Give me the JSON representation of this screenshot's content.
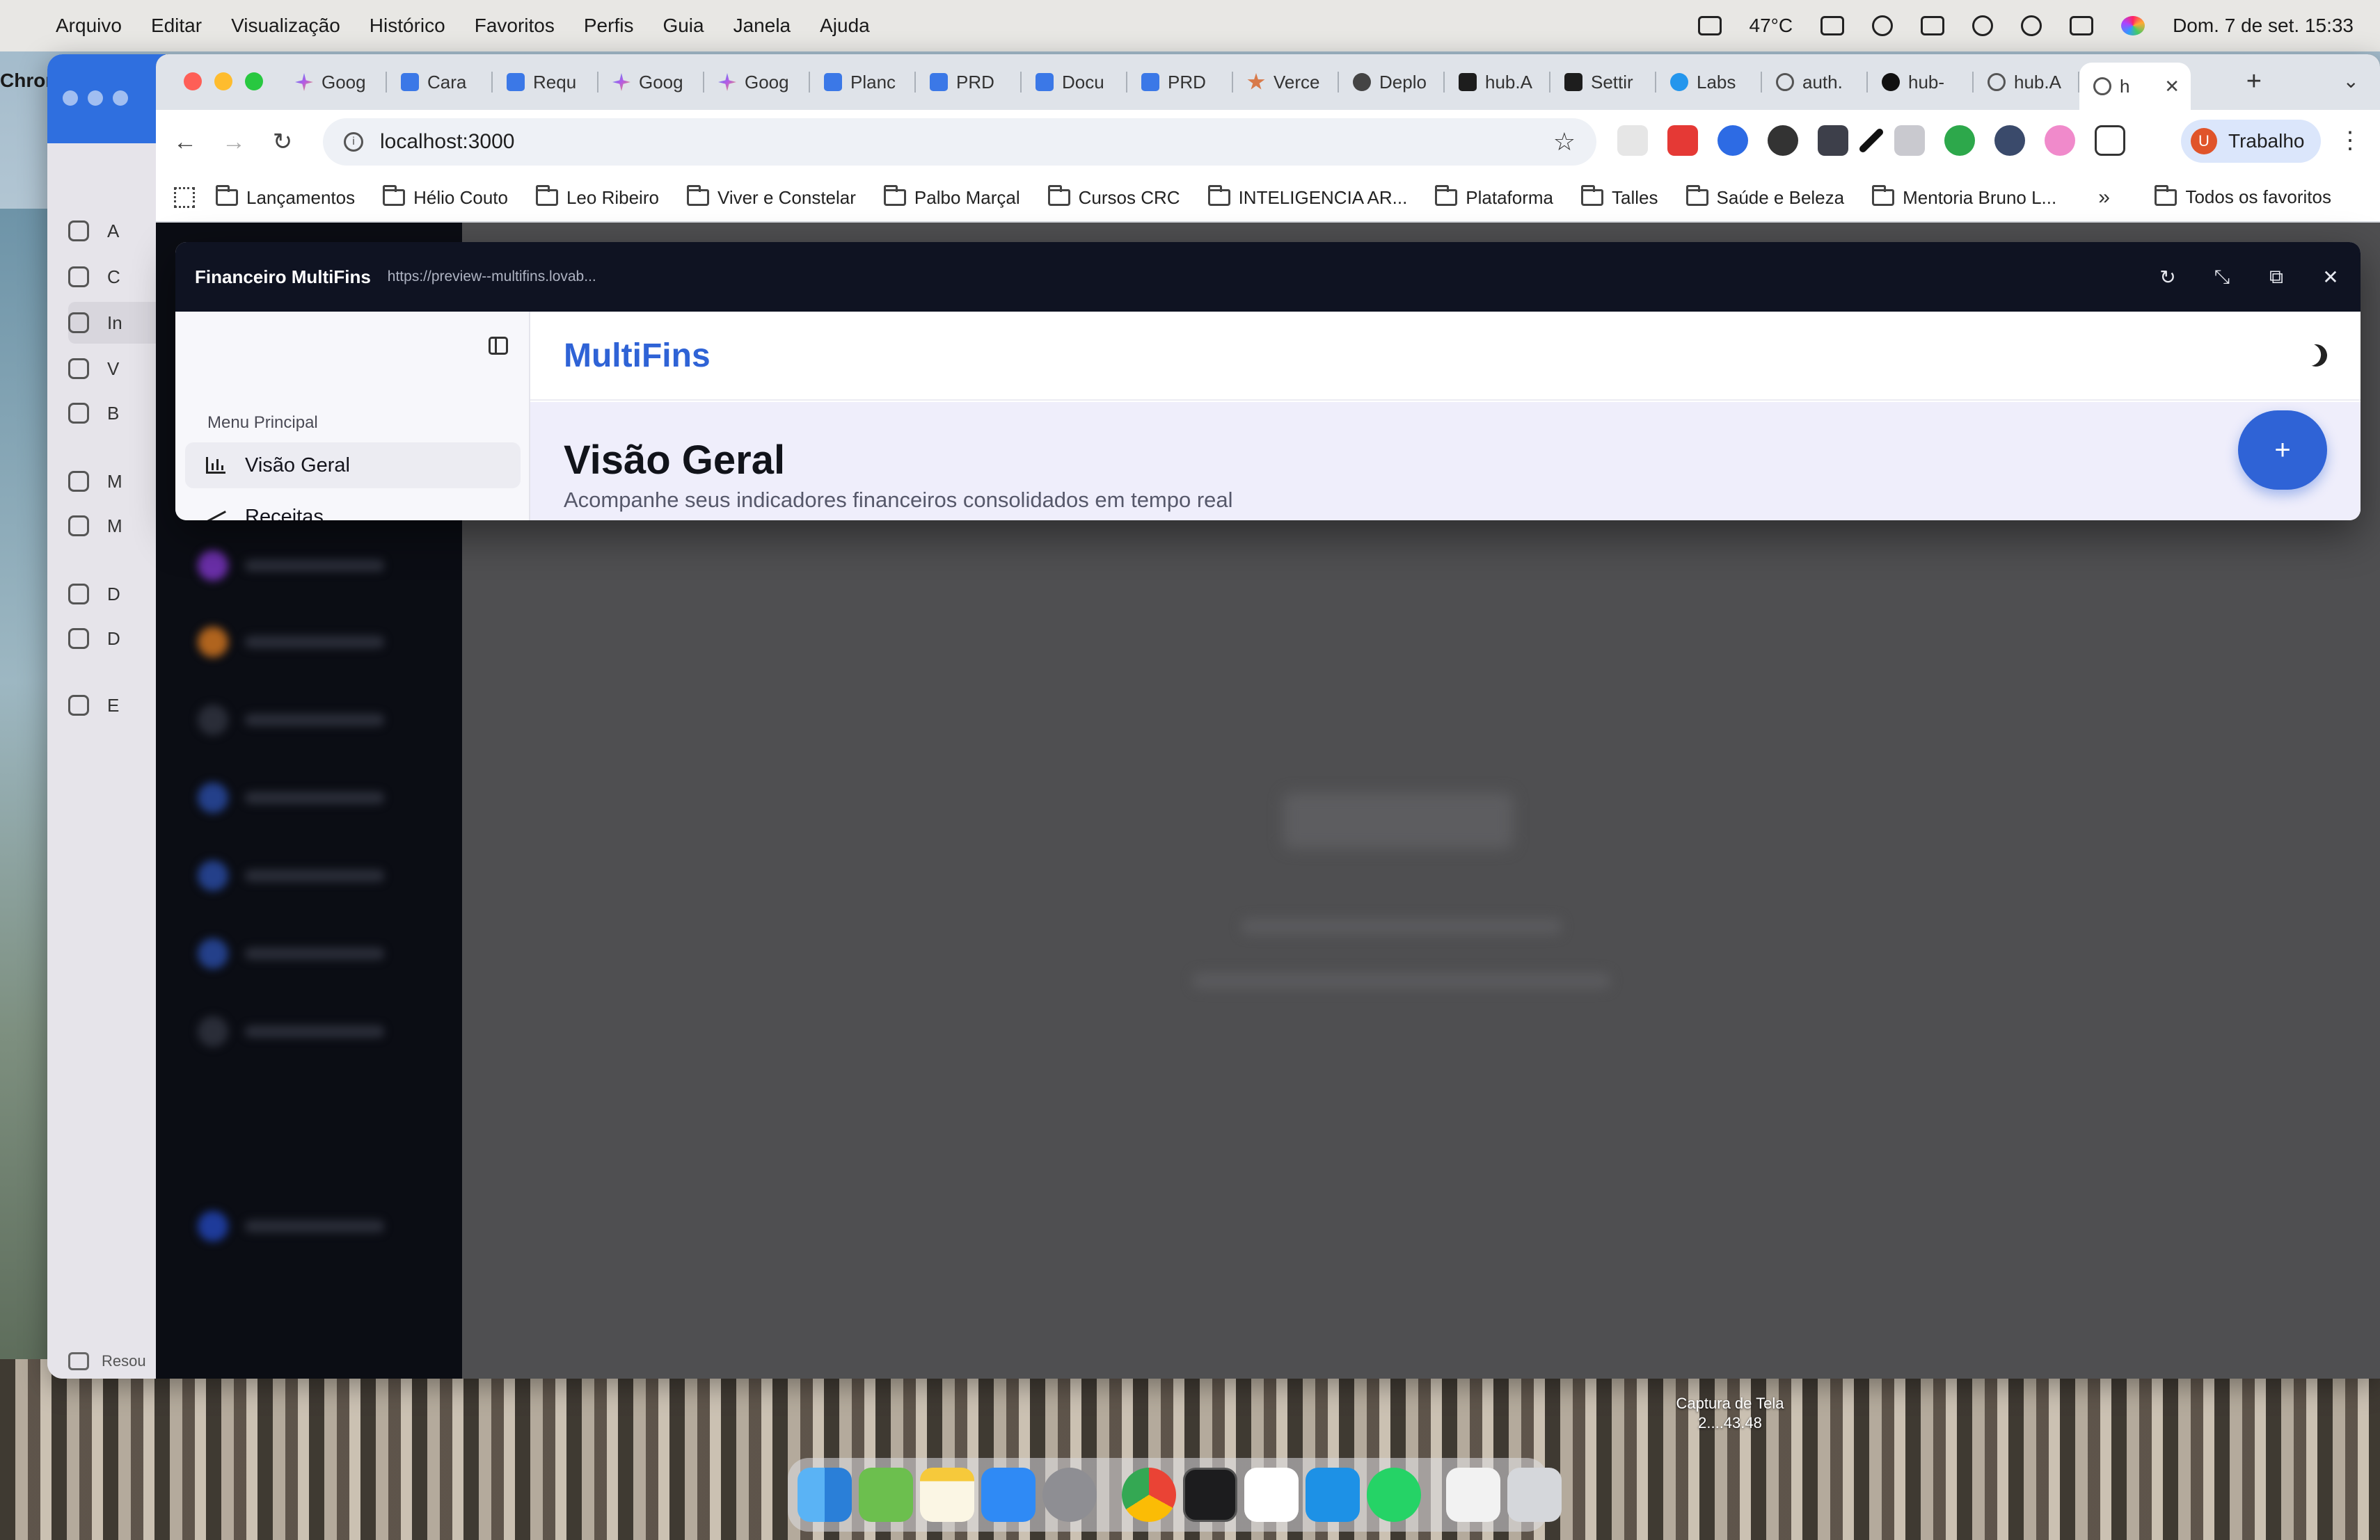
{
  "menubar": {
    "app_name": "Chrome",
    "items": [
      "Arquivo",
      "Editar",
      "Visualização",
      "Histórico",
      "Favoritos",
      "Perfis",
      "Guia",
      "Janela",
      "Ajuda"
    ],
    "temperature": "47°C",
    "datetime": "Dom. 7 de set.  15:33"
  },
  "background_app": {
    "nav_letters": [
      "A",
      "C",
      "In",
      "V",
      "B",
      "M",
      "M",
      "D",
      "D",
      "E"
    ],
    "footer_label": "Resou"
  },
  "chrome": {
    "tabs": [
      {
        "label": "Goog",
        "icon": "gemini-icon"
      },
      {
        "label": "Cara",
        "icon": "docs-icon"
      },
      {
        "label": "Requ",
        "icon": "docs-icon"
      },
      {
        "label": "Goog",
        "icon": "gemini-icon"
      },
      {
        "label": "Goog",
        "icon": "gemini-icon"
      },
      {
        "label": "Planc",
        "icon": "docs-icon"
      },
      {
        "label": "PRD",
        "icon": "docs-icon"
      },
      {
        "label": "Docu",
        "icon": "docs-icon"
      },
      {
        "label": "PRD",
        "icon": "docs-icon"
      },
      {
        "label": "Verce",
        "icon": "claude-icon"
      },
      {
        "label": "Deplo",
        "icon": "copilot-icon"
      },
      {
        "label": "hub.A",
        "icon": "bolt-icon"
      },
      {
        "label": "Settir",
        "icon": "bolt-icon"
      },
      {
        "label": "Labs",
        "icon": "docker-icon"
      },
      {
        "label": "auth.",
        "icon": "globe-icon"
      },
      {
        "label": "hub-",
        "icon": "triangle-icon"
      },
      {
        "label": "hub.A",
        "icon": "globe-icon"
      },
      {
        "label": "h",
        "icon": "globe-icon",
        "active": true
      }
    ],
    "new_tab_label": "+",
    "address": "localhost:3000",
    "profile_initial": "U",
    "profile_label": "Trabalho",
    "bookmarks": [
      "Lançamentos",
      "Hélio Couto",
      "Leo Ribeiro",
      "Viver e Constelar",
      "Palbo Marçal",
      "Cursos CRC",
      "INTELIGENCIA AR...",
      "Plataforma",
      "Talles",
      "Saúde e Beleza",
      "Mentoria Bruno L..."
    ],
    "bookmarks_more": "»",
    "all_bookmarks": "Todos os favoritos"
  },
  "preview": {
    "title": "Financeiro MultiFins",
    "url": "https://preview--multifins.lovab..."
  },
  "app": {
    "logo": "MultiFins",
    "menu_group": "Menu Principal",
    "menu_items": [
      "Visão Geral",
      "Receitas"
    ],
    "page_title": "Visão Geral",
    "page_subtitle": "Acompanhe seus indicadores financeiros consolidados em tempo real",
    "fab_label": "+"
  },
  "desktop": {
    "screenshot_label": "Captura de Tela 2....43.48"
  },
  "colors": {
    "accent": "#2f63d6",
    "preview_header": "#0f1322",
    "app_sidebar_dark": "#0b0d14"
  }
}
